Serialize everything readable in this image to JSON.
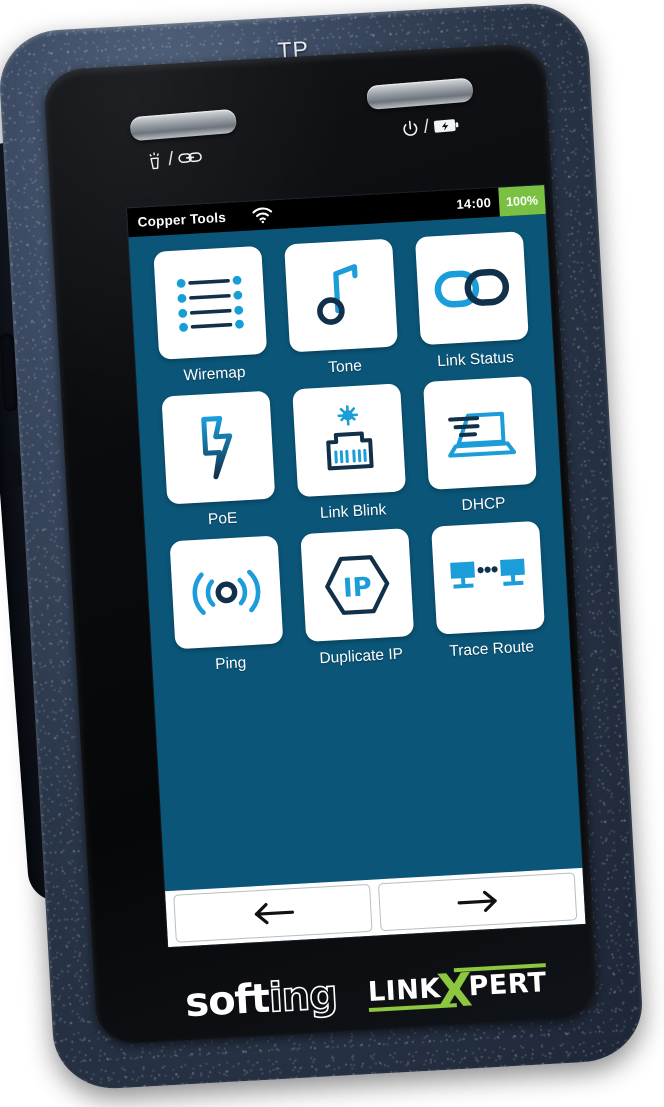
{
  "device": {
    "top_label": "TP",
    "hw_left_icons": [
      "flashlight-icon",
      "link-icon"
    ],
    "hw_right_icons": [
      "power-icon",
      "battery-icon"
    ],
    "separator": "/",
    "brand_primary": "softing",
    "brand_primary_suffix": "ing",
    "brand_primary_prefix": "soft",
    "brand_secondary_left": "LINK",
    "brand_secondary_x": "X",
    "brand_secondary_right": "PERT"
  },
  "status_bar": {
    "title": "Copper Tools",
    "wifi_icon": "wifi-icon",
    "time": "14:00",
    "battery": "100%",
    "battery_color": "#7ac143",
    "background": "#000000"
  },
  "screen": {
    "background": "#0a5578",
    "accent_light": "#1b9dd9",
    "accent_dark": "#11304a"
  },
  "apps": [
    {
      "label": "Wiremap",
      "icon": "wiremap-list-icon"
    },
    {
      "label": "Tone",
      "icon": "music-note-icon"
    },
    {
      "label": "Link Status",
      "icon": "chain-link-icon"
    },
    {
      "label": "PoE",
      "icon": "lightning-bolt-icon"
    },
    {
      "label": "Link Blink",
      "icon": "rj45-blink-icon"
    },
    {
      "label": "DHCP",
      "icon": "laptop-speed-icon"
    },
    {
      "label": "Ping",
      "icon": "signal-waves-icon"
    },
    {
      "label": "Duplicate IP",
      "icon": "hexagon-ip-icon"
    },
    {
      "label": "Trace Route",
      "icon": "two-monitors-icon"
    }
  ],
  "nav": {
    "back_label": "←",
    "forward_label": "→",
    "back_icon": "arrow-left-icon",
    "forward_icon": "arrow-right-icon"
  }
}
